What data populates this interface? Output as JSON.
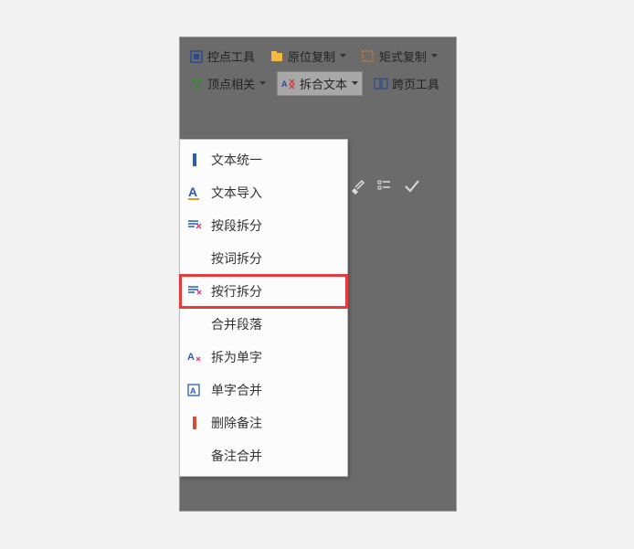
{
  "toolbar": {
    "row1": [
      {
        "label": "控点工具",
        "icon": "grid-icon",
        "hasDropdown": false
      },
      {
        "label": "原位复制",
        "icon": "folder-icon",
        "hasDropdown": true
      }
    ],
    "row2": [
      {
        "label": "矩式复制",
        "icon": "dashed-rect-icon",
        "hasDropdown": true
      },
      {
        "label": "顶点相关",
        "icon": "vertex-icon",
        "hasDropdown": true
      }
    ],
    "row3": [
      {
        "label": "拆合文本",
        "icon": "text-split-icon",
        "hasDropdown": true,
        "active": true
      },
      {
        "label": "跨页工具",
        "icon": "pages-icon",
        "hasDropdown": false
      }
    ]
  },
  "menu": {
    "items": [
      {
        "label": "文本统一",
        "icon": "text-unify-icon"
      },
      {
        "label": "文本导入",
        "icon": "text-import-icon"
      },
      {
        "label": "按段拆分",
        "icon": "para-split-icon"
      },
      {
        "label": "按词拆分",
        "icon": ""
      },
      {
        "label": "按行拆分",
        "icon": "line-split-icon",
        "highlighted": true
      },
      {
        "label": "合并段落",
        "icon": ""
      },
      {
        "label": "拆为单字",
        "icon": "char-split-icon"
      },
      {
        "label": "单字合并",
        "icon": "char-merge-icon"
      },
      {
        "label": "删除备注",
        "icon": "delete-note-icon"
      },
      {
        "label": "备注合并",
        "icon": ""
      }
    ]
  }
}
